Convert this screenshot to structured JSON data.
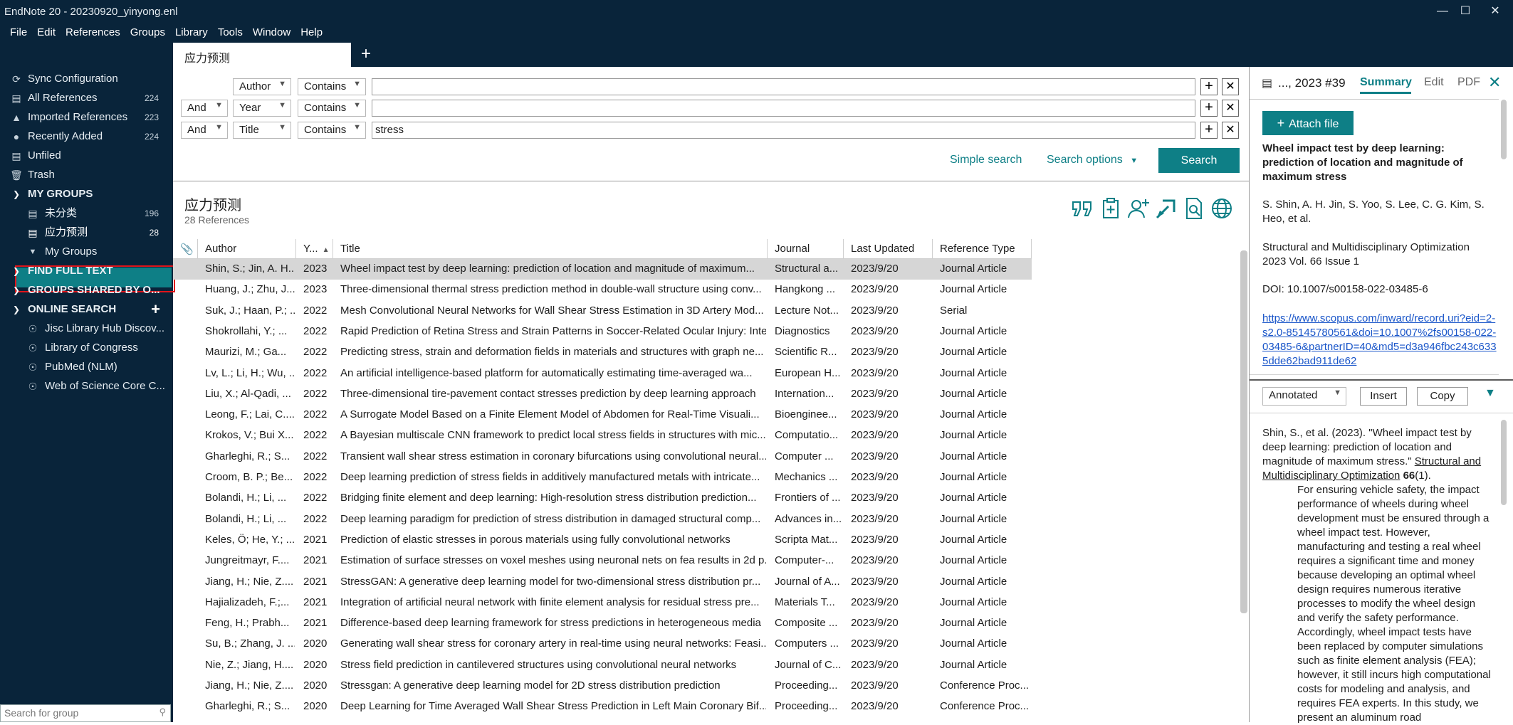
{
  "window": {
    "title": "EndNote 20 - 20230920_yinyong.enl"
  },
  "menu": [
    "File",
    "Edit",
    "References",
    "Groups",
    "Library",
    "Tools",
    "Window",
    "Help"
  ],
  "tab": {
    "label": "应力预测"
  },
  "sidebar": {
    "sync": "Sync Configuration",
    "all": {
      "label": "All References",
      "count": "224"
    },
    "imported": {
      "label": "Imported References",
      "count": "223"
    },
    "recent": {
      "label": "Recently Added",
      "count": "224"
    },
    "unfiled": "Unfiled",
    "trash": "Trash",
    "my_groups": "MY GROUPS",
    "g1": {
      "label": "未分类",
      "count": "196"
    },
    "g2": {
      "label": "应力预测",
      "count": "28"
    },
    "g3": "My Groups",
    "find_full_text": "FIND FULL TEXT",
    "groups_shared": "GROUPS SHARED BY O...",
    "online_search": "ONLINE SEARCH",
    "online": [
      "Jisc Library Hub Discov...",
      "Library of Congress",
      "PubMed (NLM)",
      "Web of Science Core C..."
    ],
    "search_placeholder": "Search for group"
  },
  "search": {
    "rows": [
      {
        "bool": "",
        "field": "Author",
        "op": "Contains",
        "value": ""
      },
      {
        "bool": "And",
        "field": "Year",
        "op": "Contains",
        "value": ""
      },
      {
        "bool": "And",
        "field": "Title",
        "op": "Contains",
        "value": "stress"
      }
    ],
    "simple_label": "Simple search",
    "options_label": "Search options",
    "button_label": "Search"
  },
  "list": {
    "title": "应力预测",
    "count": "28 References",
    "columns": [
      "Author",
      "Y...",
      "Title",
      "Journal",
      "Last Updated",
      "Reference Type"
    ],
    "rows": [
      [
        "Shin, S.; Jin, A. H...",
        "2023",
        "Wheel impact test by deep learning: prediction of location and magnitude of maximum...",
        "Structural a...",
        "2023/9/20",
        "Journal Article"
      ],
      [
        "Huang, J.; Zhu, J...",
        "2023",
        "Three-dimensional thermal stress prediction method in double-wall structure using conv...",
        "Hangkong ...",
        "2023/9/20",
        "Journal Article"
      ],
      [
        "Suk, J.; Haan, P.; ...",
        "2022",
        "Mesh Convolutional Neural Networks for Wall Shear Stress Estimation in 3D Artery Mod...",
        "Lecture Not...",
        "2023/9/20",
        "Serial"
      ],
      [
        "Shokrollahi, Y.; ...",
        "2022",
        "Rapid Prediction of Retina Stress and Strain Patterns in Soccer-Related Ocular Injury: Inte...",
        "Diagnostics",
        "2023/9/20",
        "Journal Article"
      ],
      [
        "Maurizi, M.; Ga...",
        "2022",
        "Predicting stress, strain and deformation fields in materials and structures with graph ne...",
        "Scientific R...",
        "2023/9/20",
        "Journal Article"
      ],
      [
        "Lv, L.; Li, H.; Wu, ...",
        "2022",
        "An artificial intelligence-based platform for automatically estimating time-averaged wa...",
        "European H...",
        "2023/9/20",
        "Journal Article"
      ],
      [
        "Liu, X.; Al-Qadi, ...",
        "2022",
        "Three-dimensional tire-pavement contact stresses prediction by deep learning approach",
        "Internation...",
        "2023/9/20",
        "Journal Article"
      ],
      [
        "Leong, F.; Lai, C....",
        "2022",
        "A Surrogate Model Based on a Finite Element Model of Abdomen for Real-Time Visuali...",
        "Bioenginee...",
        "2023/9/20",
        "Journal Article"
      ],
      [
        "Krokos, V.; Bui X...",
        "2022",
        "A Bayesian multiscale CNN framework to predict local stress fields in structures with mic...",
        "Computatio...",
        "2023/9/20",
        "Journal Article"
      ],
      [
        "Gharleghi, R.; S...",
        "2022",
        "Transient wall shear stress estimation in coronary bifurcations using convolutional neural...",
        "Computer ...",
        "2023/9/20",
        "Journal Article"
      ],
      [
        "Croom, B. P.; Be...",
        "2022",
        "Deep learning prediction of stress fields in additively manufactured metals with intricate...",
        "Mechanics ...",
        "2023/9/20",
        "Journal Article"
      ],
      [
        "Bolandi, H.; Li, ...",
        "2022",
        "Bridging finite element and deep learning: High-resolution stress distribution prediction...",
        "Frontiers of ...",
        "2023/9/20",
        "Journal Article"
      ],
      [
        "Bolandi, H.; Li, ...",
        "2022",
        "Deep learning paradigm for prediction of stress distribution in damaged structural comp...",
        "Advances in...",
        "2023/9/20",
        "Journal Article"
      ],
      [
        "Keles, Ö; He, Y.; ...",
        "2021",
        "Prediction of elastic stresses in porous materials using fully convolutional networks",
        "Scripta Mat...",
        "2023/9/20",
        "Journal Article"
      ],
      [
        "Jungreitmayr, F....",
        "2021",
        "Estimation of surface stresses on voxel meshes using neuronal nets on fea results in 2d p...",
        "Computer-...",
        "2023/9/20",
        "Journal Article"
      ],
      [
        "Jiang, H.; Nie, Z....",
        "2021",
        "StressGAN: A generative deep learning model for two-dimensional stress distribution pr...",
        "Journal of A...",
        "2023/9/20",
        "Journal Article"
      ],
      [
        "Hajializadeh, F.;...",
        "2021",
        "Integration of artificial neural network with finite element analysis for residual stress pre...",
        "Materials T...",
        "2023/9/20",
        "Journal Article"
      ],
      [
        "Feng, H.; Prabh...",
        "2021",
        "Difference-based deep learning framework for stress predictions in heterogeneous media",
        "Composite ...",
        "2023/9/20",
        "Journal Article"
      ],
      [
        "Su, B.; Zhang, J. ...",
        "2020",
        "Generating wall shear stress for coronary artery in real-time using neural networks: Feasi...",
        "Computers ...",
        "2023/9/20",
        "Journal Article"
      ],
      [
        "Nie, Z.; Jiang, H....",
        "2020",
        "Stress field prediction in cantilevered structures using convolutional neural networks",
        "Journal of C...",
        "2023/9/20",
        "Journal Article"
      ],
      [
        "Jiang, H.; Nie, Z....",
        "2020",
        "Stressgan: A generative deep learning model for 2D stress distribution prediction",
        "Proceeding...",
        "2023/9/20",
        "Conference Proc..."
      ],
      [
        "Gharleghi, R.; S...",
        "2020",
        "Deep Learning for Time Averaged Wall Shear Stress Prediction in Left Main Coronary Bif...",
        "Proceeding...",
        "2023/9/20",
        "Conference Proc..."
      ]
    ]
  },
  "detail": {
    "header": "..., 2023 #39",
    "tabs": {
      "summary": "Summary",
      "edit": "Edit",
      "pdf": "PDF"
    },
    "attach": "Attach file",
    "title": "Wheel impact test by deep learning: prediction of location and magnitude of maximum stress",
    "authors": "S. Shin, A. H. Jin, S. Yoo, S. Lee, C. G. Kim, S. Heo, et al.",
    "journal_line1": "Structural and Multidisciplinary Optimization",
    "journal_line2": "2023 Vol. 66 Issue 1",
    "doi": "DOI: 10.1007/s00158-022-03485-6",
    "url": "https://www.scopus.com/inward/record.uri?eid=2-s2.0-85145780561&doi=10.1007%2fs00158-022-03485-6&partnerID=40&md5=d3a946fbc243c6335dde62bad911de62",
    "style": "Annotated",
    "insert": "Insert",
    "copy": "Copy",
    "citation_pre": "Shin, S., et al. (2023). \"Wheel impact test by deep learning: prediction of location and magnitude of maximum stress.\" ",
    "citation_journal": "Structural and Multidisciplinary Optimization",
    "citation_vol": " 66",
    "citation_issue": "(1).",
    "abstract": "For ensuring vehicle safety, the impact performance of wheels during wheel development must be ensured through a wheel impact test. However, manufacturing and testing a real wheel requires a significant time and money because developing an optimal wheel design requires numerous iterative processes to modify the wheel design and verify the safety performance. Accordingly, wheel impact tests have been replaced by computer simulations such as finite element analysis (FEA); however, it still incurs high computational costs for modeling and analysis, and requires FEA experts. In this study, we present an aluminum road"
  }
}
